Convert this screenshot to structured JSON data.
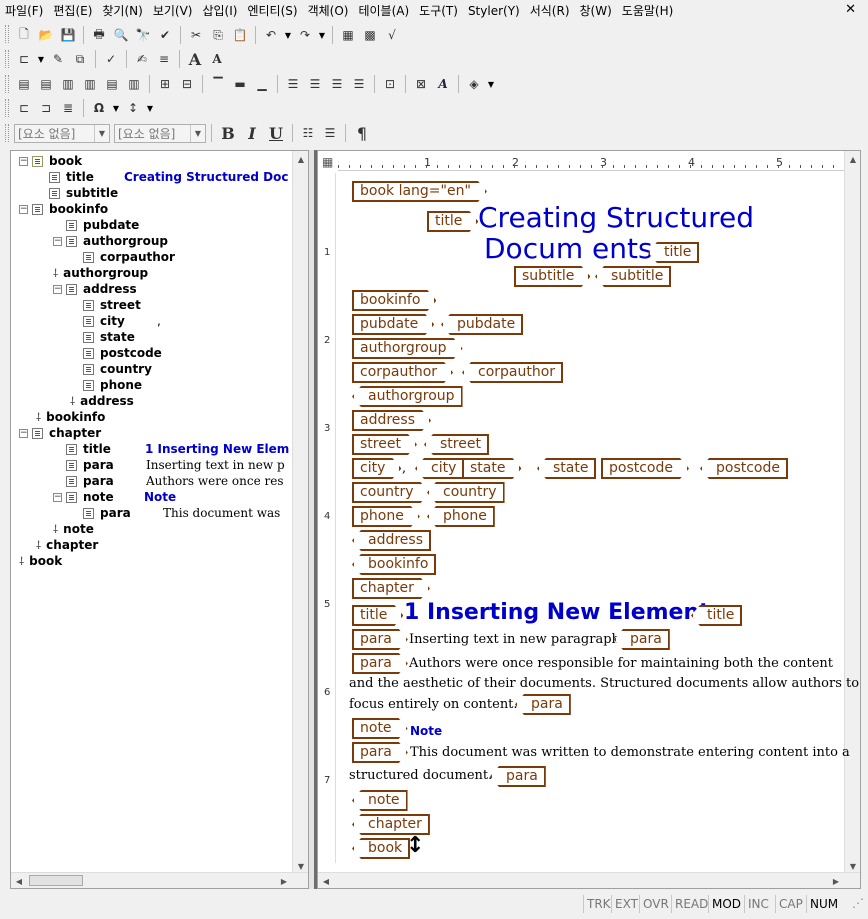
{
  "menu": [
    "파일(F)",
    "편집(E)",
    "찾기(N)",
    "보기(V)",
    "삽입(I)",
    "엔티티(S)",
    "객체(O)",
    "테이블(A)",
    "도구(T)",
    "Styler(Y)",
    "서식(R)",
    "창(W)",
    "도움말(H)"
  ],
  "toolbar": {
    "element_select_1": "[요소 없음]",
    "element_select_2": "[요소 없음]",
    "bold": "B",
    "italic": "I",
    "underline": "U",
    "pilcrow": "¶"
  },
  "tree": [
    {
      "name": "book"
    },
    {
      "name": "title",
      "value": "Creating Structured Doc"
    },
    {
      "name": "subtitle"
    },
    {
      "name": "bookinfo"
    },
    {
      "name": "pubdate"
    },
    {
      "name": "authorgroup"
    },
    {
      "name": "corpauthor"
    },
    {
      "name": "authorgroup"
    },
    {
      "name": "address"
    },
    {
      "name": "street"
    },
    {
      "name": "city",
      "value": ","
    },
    {
      "name": "state"
    },
    {
      "name": "postcode"
    },
    {
      "name": "country"
    },
    {
      "name": "phone"
    },
    {
      "name": "address"
    },
    {
      "name": "bookinfo"
    },
    {
      "name": "chapter"
    },
    {
      "name": "title",
      "value": "1 Inserting New Elem"
    },
    {
      "name": "para",
      "value": "Inserting text in new p"
    },
    {
      "name": "para",
      "value": "Authors were once res"
    },
    {
      "name": "note",
      "value": "Note"
    },
    {
      "name": "para",
      "value": "This document was"
    },
    {
      "name": "note"
    },
    {
      "name": "chapter"
    },
    {
      "name": "book"
    }
  ],
  "ruler": [
    "1",
    "2",
    "3",
    "4",
    "5"
  ],
  "vruler": [
    "1",
    "2",
    "3",
    "4",
    "5",
    "6",
    "7"
  ],
  "doc": {
    "book_open": "book lang=\"en\"",
    "title_tag": "title",
    "title_line1": "Creating Structured",
    "title_line2": "Docum ents",
    "subtitle_tag": "subtitle",
    "bookinfo": "bookinfo",
    "pubdate": "pubdate",
    "authorgroup": "authorgroup",
    "corpauthor": "corpauthor",
    "address": "address",
    "street": "street",
    "city": "city",
    "city_comma": ",",
    "state": "state",
    "postcode": "postcode",
    "country": "country",
    "phone": "phone",
    "chapter": "chapter",
    "chapter_title": "1 Inserting New Elements",
    "para": "para",
    "para1": "Inserting text in new paragraph",
    "para2_l1": "Authors were once responsible for maintaining both the content",
    "para2_l2": "and the aesthetic of their documents. Structured documents allow authors to",
    "para2_l3": "focus entirely on content.",
    "note": "note",
    "note_text": "Note",
    "para3_l1": "This document was written to demonstrate entering content into a",
    "para3_l2": "structured document.",
    "book": "book"
  },
  "status": [
    "TRK",
    "EXT",
    "OVR",
    "READ",
    "MOD",
    "INC",
    "CAP",
    "NUM"
  ],
  "status_active": [
    "MOD",
    "NUM"
  ],
  "colors": {
    "tag": "#7a3a0a",
    "title": "#0000cc"
  }
}
